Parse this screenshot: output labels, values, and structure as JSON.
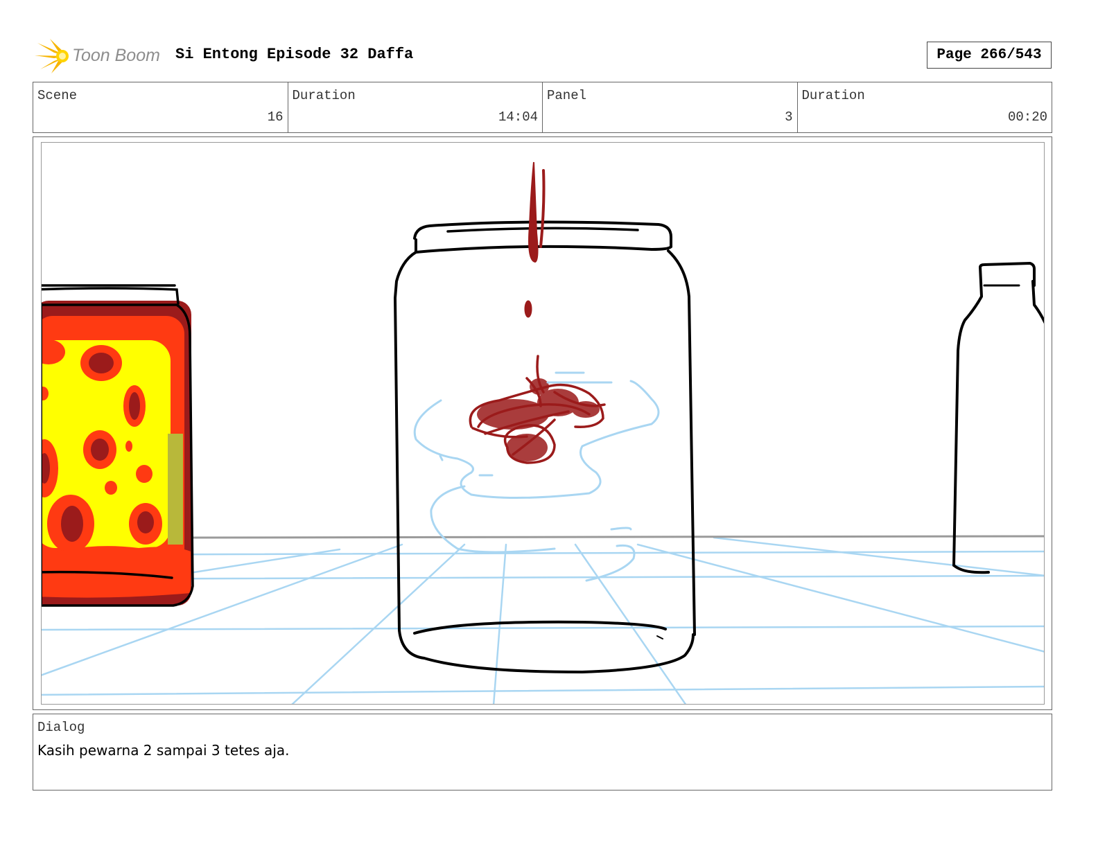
{
  "header": {
    "logo_text": "Toon Boom",
    "title": "Si Entong Episode 32 Daffa",
    "page": "Page 266/543"
  },
  "info": {
    "scene_label": "Scene",
    "scene_value": "16",
    "duration_label": "Duration",
    "duration_value": "14:04",
    "panel_label": "Panel",
    "panel_value": "3",
    "panel_duration_label": "Duration",
    "panel_duration_value": "00:20"
  },
  "dialog": {
    "label": "Dialog",
    "text": "Kasih pewarna 2 sampai 3 tetes aja."
  },
  "colors": {
    "sketch_line": "#000000",
    "guide_blue": "#a9d6f2",
    "drop_red": "#9b1b1b",
    "jar_yellow": "#ffff00",
    "jar_orange": "#ff3a12"
  },
  "icons": {
    "logo": "starburst-icon"
  }
}
